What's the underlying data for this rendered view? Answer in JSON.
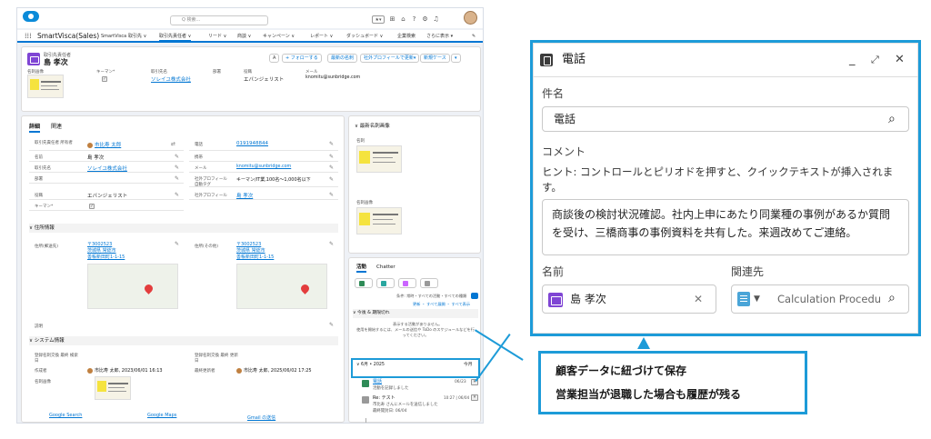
{
  "app": {
    "search_placeholder": "Q 検索...",
    "app_name": "SmartVisca(Sales)",
    "nav_items": [
      "SmartVisca",
      "取引先 ∨",
      "取引先責任者 ∨",
      "リード ∨",
      "商談 ∨",
      "キャンペーン ∨",
      "レポート ∨",
      "ダッシュボード ∨",
      "企業検索",
      "さらに表示 ▾"
    ],
    "record": {
      "object_label": "取引先責任者",
      "name": "島 孝次",
      "buttons": [
        "+ フォローする",
        "最新の名刺",
        "社外プロフィールで更新▾",
        "新規ケース",
        "▾"
      ],
      "fields": [
        {
          "label": "名刺画像",
          "value": ""
        },
        {
          "label": "キーマン*",
          "value": ""
        },
        {
          "label": "取引先名",
          "value": "ソレイユ株式会社"
        },
        {
          "label": "部署",
          "value": ""
        },
        {
          "label": "役職",
          "value": "エバンジェリスト"
        },
        {
          "label": "メール",
          "value": "knomitu@sunbridge.com"
        }
      ]
    },
    "detail": {
      "tabs": [
        "詳細",
        "関連"
      ],
      "left_rows": [
        {
          "label": "取引先責任者 所有者",
          "value": "市比寿 太郎"
        },
        {
          "label": "名前",
          "value": "島 孝次"
        },
        {
          "label": "取引先名",
          "value": "ソレイユ株式会社"
        },
        {
          "label": "部署",
          "value": ""
        },
        {
          "label": "役職",
          "value": "エバンジェリスト"
        },
        {
          "label": "キーマン*",
          "value": ""
        }
      ],
      "right_rows": [
        {
          "label": "電話",
          "value": "0191948844"
        },
        {
          "label": "携帯",
          "value": ""
        },
        {
          "label": "メール",
          "value": "knomitu@sunbridge.com"
        },
        {
          "label": "社外プロフィール 自動タグ",
          "value": "キーマン/IT業,100名〜1,000名以下"
        },
        {
          "label": "社外プロフィール",
          "value": "島 孝次"
        }
      ],
      "address_section": "∨ 住所情報",
      "addr_left_label": "住所(郵送先)",
      "addr_right_label": "住所(その他)",
      "addr_lines": [
        "〒3002523",
        "茨城県 常総市",
        "善帳新田町1-1-15"
      ],
      "addr_lines_right": [
        "〒3002523",
        "茨城県 常総市",
        "善帳新田町1-1-15"
      ],
      "notes_label": "説明",
      "system_section": "∨ システム情報",
      "sys_left_label": "登録名刺交換 最終 検索日",
      "sys_right_label": "登録名刺交換 最終 更新日",
      "creator_label": "作成者",
      "creator_value": "市比寿 太郎, 2023/06/01 16:13",
      "updater_label": "最終更新者",
      "updater_value": "市比寿 太郎, 2025/06/02 17:25",
      "card_label": "名刺画像",
      "links": [
        "Google Search",
        "Google Maps",
        "Gmail の送信"
      ]
    },
    "right_panel": {
      "title": "∨ 最新名刺画像",
      "front_label": "名刺",
      "back_label": "名刺画像"
    },
    "activity": {
      "tabs": [
        "活動",
        "Chatter"
      ],
      "filter_text": "条件: 常時・すべての活動・すべての種類",
      "filter_links": "更新 ・ すべて展開 ・ すべて表示",
      "upcoming": "∨ 今後 & 期限切れ",
      "empty1": "表示する活動がありません。",
      "empty2": "使用を開始するには、メールの送信や ToDo のスケジュールなどを行ってください。",
      "month": "∨ 6月 • 2025",
      "month_right": "今月",
      "item_title": "電話",
      "item_sub": "活動を記録しました",
      "item_date": "06/23",
      "item2_title": "Re: テスト",
      "item2_date": "10:27 | 06/04",
      "item2_line1": "市比寿 さんにメールを送信しました",
      "item2_line2": "最終開封日: 06/04"
    }
  },
  "modal": {
    "title": "電話",
    "subject_label": "件名",
    "subject_value": "電話",
    "comment_label": "コメント",
    "hint": "ヒント: コントロールとピリオドを押すと、クイックテキストが挿入されます。",
    "comment_value": "商談後の検討状況確認。社内上申にあたり同業種の事例があるか質問を受け、三橋商事の事例資料を共有した。来週改めてご連絡。",
    "name_label": "名前",
    "name_value": "島 孝次",
    "related_label": "関連先",
    "related_value": "Calculation Procedu"
  },
  "callout": {
    "line1": "顧客データに紐づけて保存",
    "line2": "営業担当が退職した場合も履歴が残る"
  },
  "colors": {
    "accent": "#1d9bd8",
    "brand": "#0176d3",
    "contact_icon": "#7f45d4"
  }
}
